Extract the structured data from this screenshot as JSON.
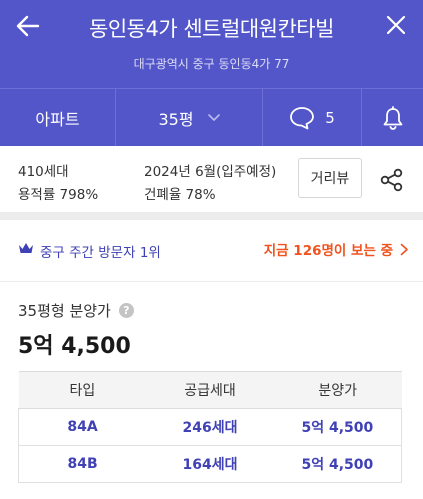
{
  "header": {
    "title": "동인동4가 센트럴대원칸타빌",
    "address": "대구광역시 중구 동인동4가 77"
  },
  "tabs": {
    "type_label": "아파트",
    "size_label": "35평",
    "comment_count": "5"
  },
  "info": {
    "households": "410세대",
    "floor_area_ratio": "용적률 798%",
    "move_in": "2024년 6월(입주예정)",
    "building_coverage": "건폐율 78%",
    "distance_button": "거리뷰"
  },
  "ranking": {
    "text": "중구 주간 방문자 1위",
    "now_viewing": "지금 126명이 보는 중"
  },
  "sale": {
    "title": "35평형 분양가",
    "help": "?",
    "price": "5억 4,500"
  },
  "table": {
    "headers": [
      "타입",
      "공급세대",
      "분양가"
    ],
    "rows": [
      [
        "84A",
        "246세대",
        "5억 4,500"
      ],
      [
        "84B",
        "164세대",
        "5억 4,500"
      ]
    ]
  },
  "colors": {
    "header_bg": "#5356c9",
    "accent_blue": "#3f41b5",
    "accent_orange": "#f0531e"
  },
  "icons": [
    "back-arrow-icon",
    "close-icon",
    "chevron-down-icon",
    "comment-icon",
    "bell-icon",
    "share-icon",
    "crown-icon",
    "chevron-right-icon",
    "help-icon"
  ]
}
